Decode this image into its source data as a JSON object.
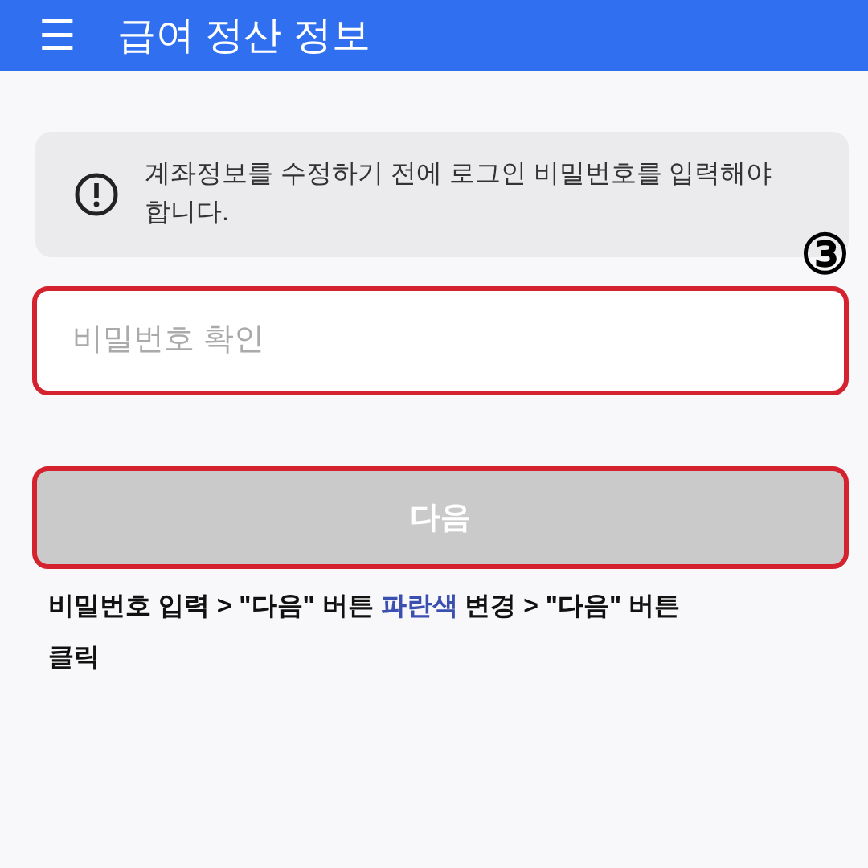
{
  "app_bar": {
    "menu_icon": "☰",
    "title": "급여 정산 정보"
  },
  "notice": {
    "text": "계좌정보를 수정하기 전에 로그인 비밀번호를 입력해야 합니다."
  },
  "step_marker": "③",
  "password_field": {
    "placeholder": "비밀번호 확인",
    "highlighted": true
  },
  "next_button": {
    "label": "다음",
    "disabled": true,
    "highlighted": true
  },
  "instruction": [
    {
      "text": "비밀번호 입력 > \"다음\" 버튼 ",
      "highlighted": false
    },
    {
      "text": "파란색",
      "highlighted": true
    },
    {
      "text": " 변경 > \"다음\" 버튼 클릭",
      "highlighted": false
    }
  ]
}
